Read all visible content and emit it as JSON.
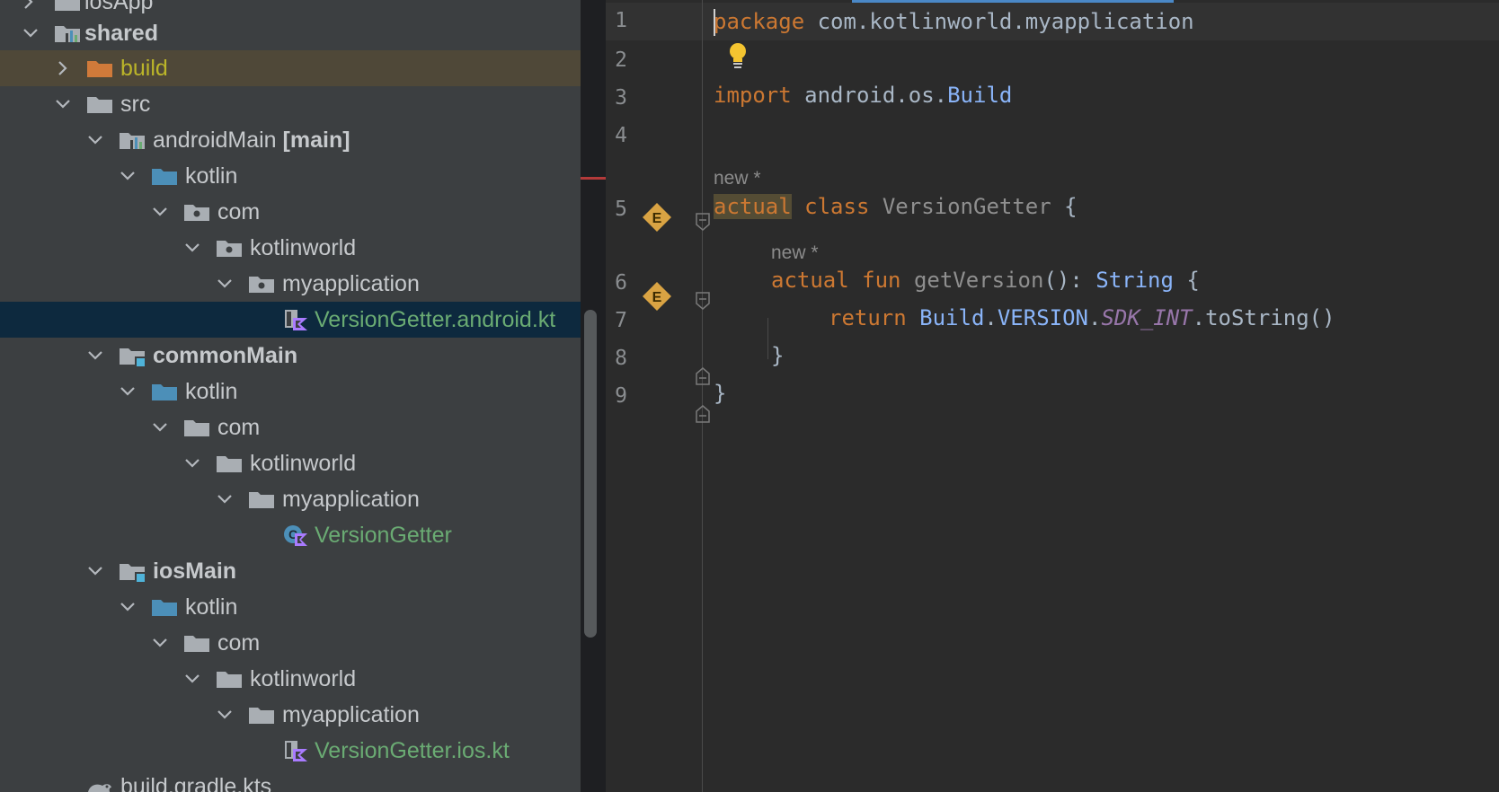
{
  "tree": {
    "rows": [
      {
        "label": "iosApp"
      },
      {
        "label": "shared"
      },
      {
        "label": "build"
      },
      {
        "label": "src"
      },
      {
        "label": "androidMain",
        "tag": "[main]"
      },
      {
        "label": "kotlin"
      },
      {
        "label": "com"
      },
      {
        "label": "kotlinworld"
      },
      {
        "label": "myapplication"
      },
      {
        "label": "VersionGetter.android.kt"
      },
      {
        "label": "commonMain"
      },
      {
        "label": "kotlin"
      },
      {
        "label": "com"
      },
      {
        "label": "kotlinworld"
      },
      {
        "label": "myapplication"
      },
      {
        "label": "VersionGetter"
      },
      {
        "label": "iosMain"
      },
      {
        "label": "kotlin"
      },
      {
        "label": "com"
      },
      {
        "label": "kotlinworld"
      },
      {
        "label": "myapplication"
      },
      {
        "label": "VersionGetter.ios.kt"
      },
      {
        "label": "build.gradle.kts"
      }
    ]
  },
  "editor": {
    "line_numbers": [
      "1",
      "2",
      "3",
      "4",
      "5",
      "6",
      "7",
      "8",
      "9"
    ],
    "hints": [
      "new *",
      "new *"
    ],
    "lines": {
      "l1": {
        "kw": "package",
        "rest": " com.kotlinworld.myapplication"
      },
      "l3": {
        "kw": "import",
        "pkg": " android.os.",
        "type": "Build"
      },
      "l5": {
        "kw1": "actual",
        "kw2": " class ",
        "name": "VersionGetter",
        "rest": " {"
      },
      "l6": {
        "kw1": "actual",
        "kw2": " fun ",
        "name": "getVersion",
        "punc": "(): ",
        "type": "String",
        "rest": " {"
      },
      "l7": {
        "kw": "return ",
        "t1": "Build",
        "dot1": ".",
        "t2": "VERSION",
        "dot2": ".",
        "sdk": "SDK_INT",
        "rest": ".toString()"
      },
      "l8": {
        "text": "}"
      },
      "l9": {
        "text": "}"
      }
    },
    "marker_letter": "E"
  },
  "colors": {
    "tree_bg": "#3c3f41",
    "editor_bg": "#2b2b2b",
    "keyword": "#cc7832",
    "selection": "#0d293e",
    "build_highlight": "#4f4838",
    "kotlin_file_green": "#6aab73"
  }
}
